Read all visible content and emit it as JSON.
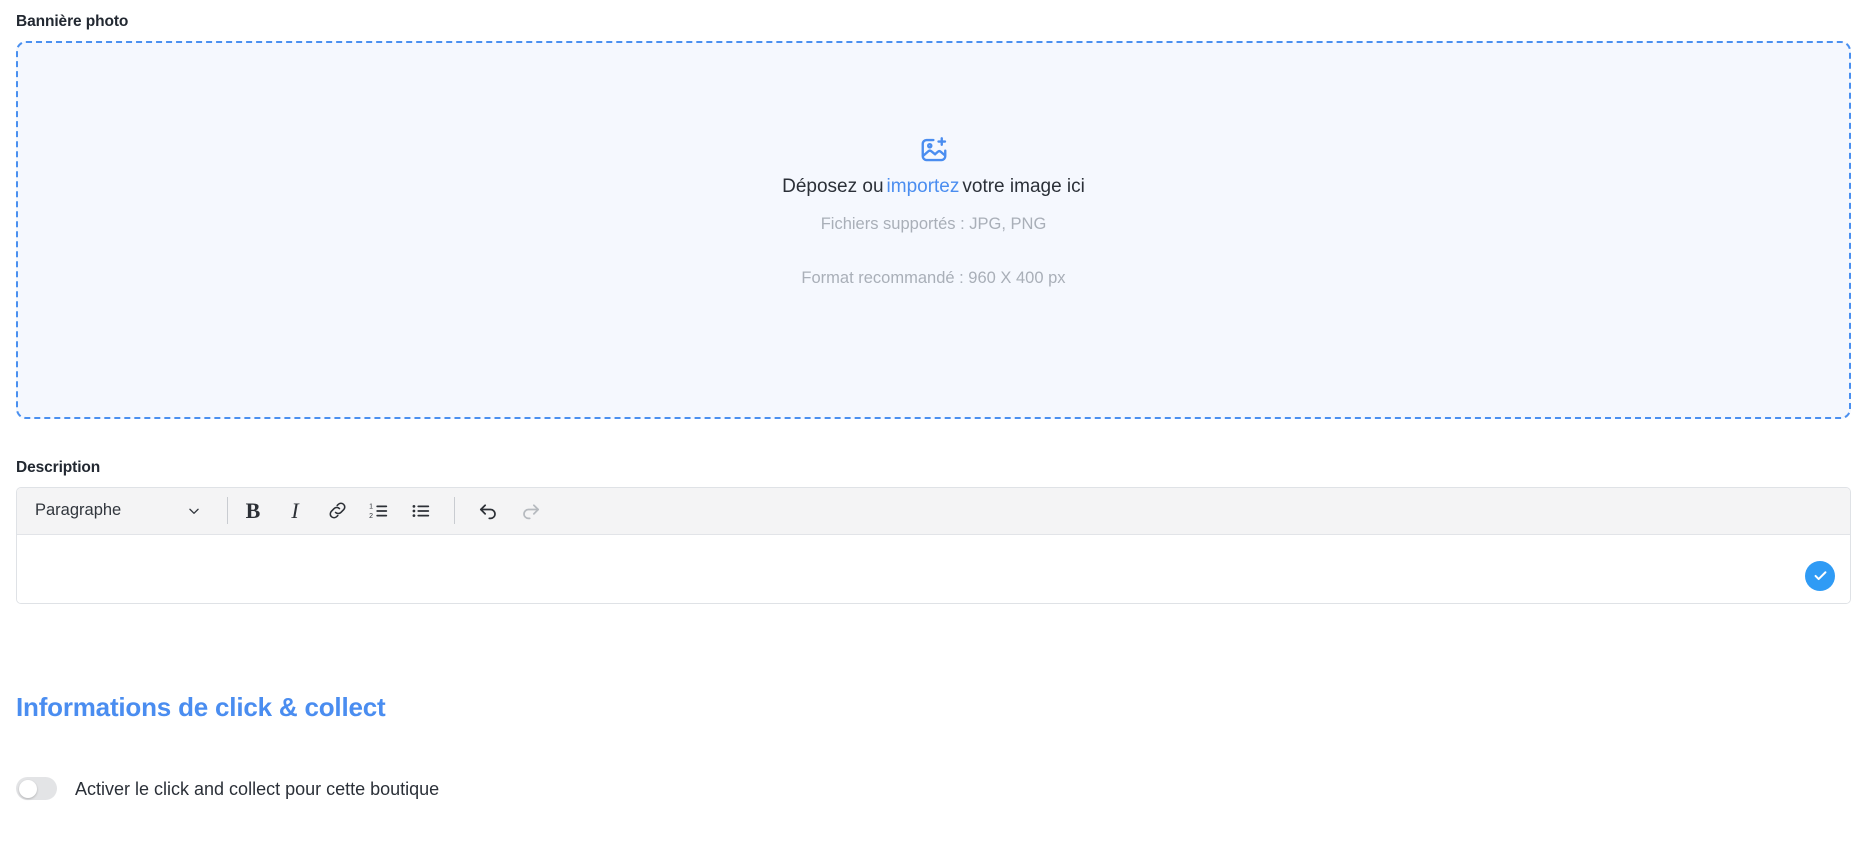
{
  "banner": {
    "label": "Bannière photo",
    "dropzone": {
      "icon": "image-plus-icon",
      "prompt_before": "Déposez ou",
      "prompt_link": "importez",
      "prompt_after": "votre image ici",
      "supported_files": "Fichiers supportés : JPG, PNG",
      "recommended_format": "Format recommandé : 960 X 400 px",
      "border_color": "#4a90f0",
      "background_color": "#f5f8fe",
      "link_color": "#4a8df0"
    }
  },
  "description": {
    "label": "Description",
    "toolbar": {
      "block_style_selected": "Paragraphe",
      "block_style_options": [
        "Paragraphe"
      ],
      "chevron_icon": "chevron-down-icon",
      "buttons": [
        {
          "name": "bold",
          "label": "B",
          "icon": "bold-icon",
          "disabled": false
        },
        {
          "name": "italic",
          "label": "I",
          "icon": "italic-icon",
          "disabled": false
        },
        {
          "name": "link",
          "label": "",
          "icon": "link-icon",
          "disabled": false
        },
        {
          "name": "ordered-list",
          "label": "",
          "icon": "ordered-list-icon",
          "disabled": false
        },
        {
          "name": "bullet-list",
          "label": "",
          "icon": "bullet-list-icon",
          "disabled": false
        },
        {
          "name": "undo",
          "label": "",
          "icon": "undo-icon",
          "disabled": false
        },
        {
          "name": "redo",
          "label": "",
          "icon": "redo-icon",
          "disabled": true
        }
      ]
    },
    "content": "",
    "placeholder": "",
    "confirm_button": {
      "icon": "check-circle-icon",
      "color": "#2f9bf5"
    }
  },
  "click_and_collect": {
    "title": "Informations de click & collect",
    "title_color": "#4a8df0",
    "toggle": {
      "label": "Activer le click and collect pour cette boutique",
      "enabled": false,
      "off_color": "#e3e4e6",
      "on_color": "#2f9bf5"
    }
  }
}
